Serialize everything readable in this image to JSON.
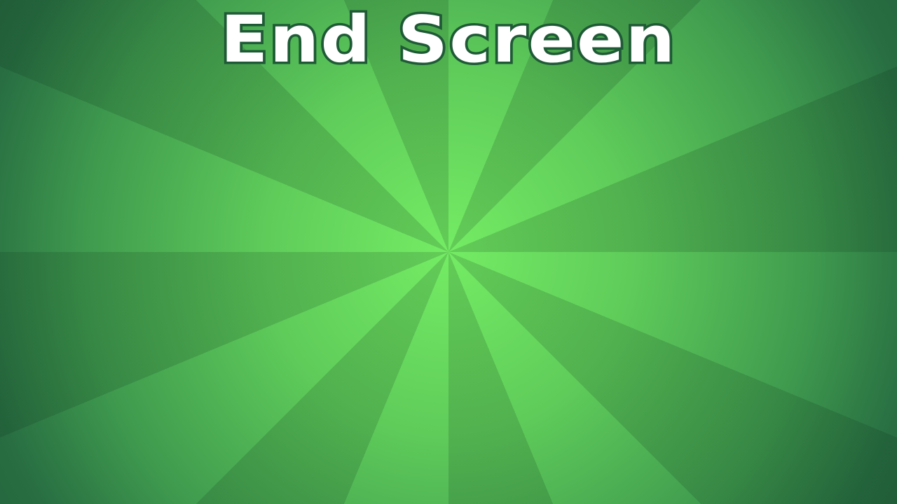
{
  "title": "End Screen",
  "colors": {
    "center": "#74ec64",
    "edge": "#22603c",
    "title_fill": "#ffffff",
    "title_outline": "#1f5a36"
  }
}
